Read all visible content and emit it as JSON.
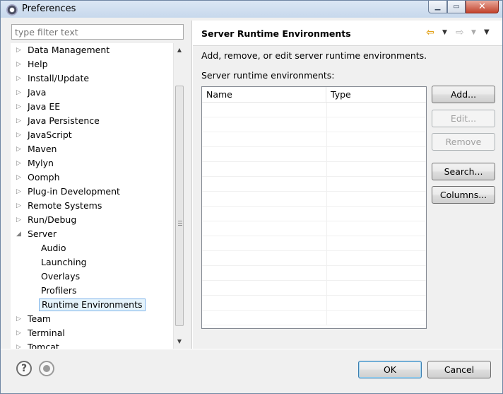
{
  "window": {
    "title": "Preferences"
  },
  "filter": {
    "placeholder": "type filter text"
  },
  "tree": {
    "items": [
      {
        "label": "Data Management",
        "level": 0,
        "expander": "collapsed"
      },
      {
        "label": "Help",
        "level": 0,
        "expander": "collapsed"
      },
      {
        "label": "Install/Update",
        "level": 0,
        "expander": "collapsed"
      },
      {
        "label": "Java",
        "level": 0,
        "expander": "collapsed"
      },
      {
        "label": "Java EE",
        "level": 0,
        "expander": "collapsed"
      },
      {
        "label": "Java Persistence",
        "level": 0,
        "expander": "collapsed"
      },
      {
        "label": "JavaScript",
        "level": 0,
        "expander": "collapsed"
      },
      {
        "label": "Maven",
        "level": 0,
        "expander": "collapsed"
      },
      {
        "label": "Mylyn",
        "level": 0,
        "expander": "collapsed"
      },
      {
        "label": "Oomph",
        "level": 0,
        "expander": "collapsed"
      },
      {
        "label": "Plug-in Development",
        "level": 0,
        "expander": "collapsed"
      },
      {
        "label": "Remote Systems",
        "level": 0,
        "expander": "collapsed"
      },
      {
        "label": "Run/Debug",
        "level": 0,
        "expander": "collapsed"
      },
      {
        "label": "Server",
        "level": 0,
        "expander": "expanded"
      },
      {
        "label": "Audio",
        "level": 1,
        "expander": "none"
      },
      {
        "label": "Launching",
        "level": 1,
        "expander": "none"
      },
      {
        "label": "Overlays",
        "level": 1,
        "expander": "none"
      },
      {
        "label": "Profilers",
        "level": 1,
        "expander": "none"
      },
      {
        "label": "Runtime Environments",
        "level": 1,
        "expander": "none",
        "selected": true
      },
      {
        "label": "Team",
        "level": 0,
        "expander": "collapsed"
      },
      {
        "label": "Terminal",
        "level": 0,
        "expander": "collapsed"
      },
      {
        "label": "Tomcat",
        "level": 0,
        "expander": "collapsed"
      }
    ]
  },
  "page": {
    "title": "Server Runtime Environments",
    "description": "Add, remove, or edit server runtime environments.",
    "list_label": "Server runtime environments:",
    "table": {
      "columns": [
        "Name",
        "Type"
      ],
      "rows": []
    },
    "buttons": {
      "add": "Add...",
      "edit": "Edit...",
      "remove": "Remove",
      "search": "Search...",
      "columns": "Columns..."
    }
  },
  "footer": {
    "ok": "OK",
    "cancel": "Cancel"
  },
  "colors": {
    "selection_bg": "#e5f3fb",
    "selection_border": "#7eb4ea",
    "back_arrow": "#e3a21a"
  }
}
